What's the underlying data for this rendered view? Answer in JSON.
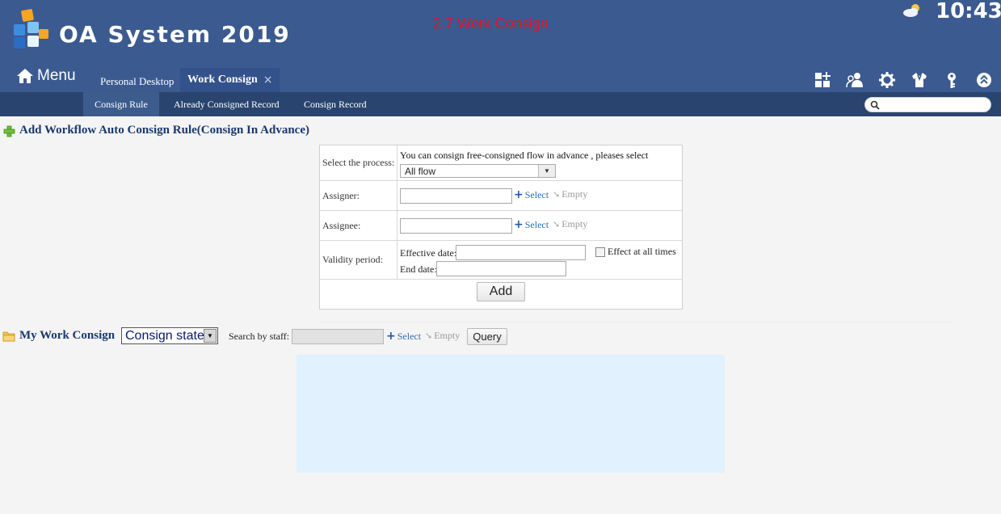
{
  "header": {
    "app_title": "OA System 2019",
    "page_caption": "2.7 Work Consign",
    "clock": "10:43",
    "weather_icon": "partly-cloudy-icon"
  },
  "nav": {
    "menu_label": "Menu",
    "tabs": [
      {
        "label": "Personal Desktop",
        "active": false
      },
      {
        "label": "Work Consign",
        "active": true,
        "closable": true
      }
    ],
    "close_glyph": "×",
    "right_icons": [
      "apps-icon",
      "users-icon",
      "gear-icon",
      "shirt-icon",
      "key-icon",
      "collapse-icon"
    ]
  },
  "subnav": {
    "items": [
      {
        "label": "Consign Rule",
        "active": true
      },
      {
        "label": "Already Consigned Record",
        "active": false
      },
      {
        "label": "Consign Record",
        "active": false
      }
    ],
    "search_placeholder": ""
  },
  "add_rule": {
    "title": "Add Workflow Auto Consign Rule(Consign In Advance)",
    "process": {
      "label": "Select the process:",
      "hint": "You can consign free-consigned flow in advance , pleases select",
      "selected": "All flow"
    },
    "assigner": {
      "label": "Assigner:",
      "value": ""
    },
    "assignee": {
      "label": "Assignee:",
      "value": ""
    },
    "select_label": "Select",
    "empty_label": "Empty",
    "validity": {
      "label": "Validity period:",
      "effective_label": "Effective date:",
      "end_label": "End date:",
      "effect_all_label": "Effect at all times"
    },
    "add_button": "Add"
  },
  "my_consign": {
    "title": "My Work Consign",
    "state_selected": "Consign state",
    "search_label": "Search by staff:",
    "select_label": "Select",
    "empty_label": "Empty",
    "query_button": "Query"
  },
  "colors": {
    "header_bg": "#3b5a90",
    "subnav_bg": "#29446f",
    "caption_red": "#e0142a",
    "title_blue": "#19396e",
    "result_panel": "#e1f1fd"
  }
}
